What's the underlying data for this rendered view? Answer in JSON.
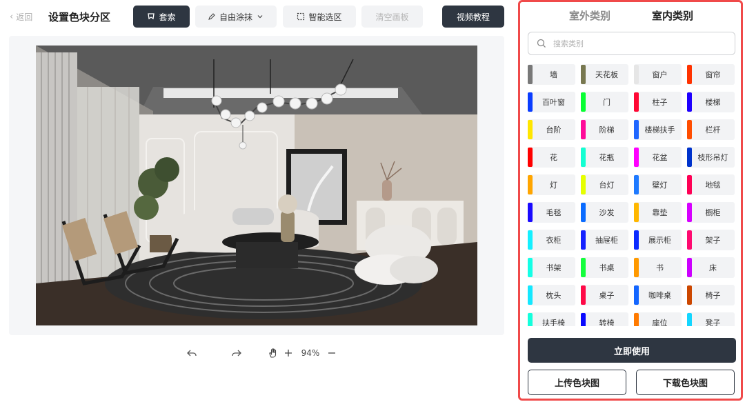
{
  "header": {
    "back_label": "返回",
    "title": "设置色块分区",
    "tools": {
      "lasso": "套索",
      "brush": "自由涂抹",
      "smart": "智能选区",
      "clear": "清空画板"
    },
    "video_tutorial": "视频教程"
  },
  "canvas": {
    "zoom": "94%"
  },
  "panel": {
    "tabs": [
      {
        "label": "室外类别",
        "active": false
      },
      {
        "label": "室内类别",
        "active": true
      }
    ],
    "search_placeholder": "搜索类别",
    "categories": [
      {
        "label": "墙",
        "color": "#787878"
      },
      {
        "label": "天花板",
        "color": "#787850"
      },
      {
        "label": "窗户",
        "color": "#e6e6e6"
      },
      {
        "label": "窗帘",
        "color": "#ff3300"
      },
      {
        "label": "百叶窗",
        "color": "#0a3dff"
      },
      {
        "label": "门",
        "color": "#08ff33"
      },
      {
        "label": "柱子",
        "color": "#ff0834"
      },
      {
        "label": "楼梯",
        "color": "#1f00ff"
      },
      {
        "label": "台阶",
        "color": "#ffe600"
      },
      {
        "label": "阶梯",
        "color": "#ff0a99"
      },
      {
        "label": "楼梯扶手",
        "color": "#1f66ff"
      },
      {
        "label": "栏杆",
        "color": "#ff4d00"
      },
      {
        "label": "花",
        "color": "#ff0000"
      },
      {
        "label": "花瓶",
        "color": "#14ffd2"
      },
      {
        "label": "花盆",
        "color": "#ff00ff"
      },
      {
        "label": "枝形吊灯",
        "color": "#0033cc"
      },
      {
        "label": "灯",
        "color": "#ffa500"
      },
      {
        "label": "台灯",
        "color": "#e6ff00"
      },
      {
        "label": "壁灯",
        "color": "#1f7aff"
      },
      {
        "label": "地毯",
        "color": "#ff0055"
      },
      {
        "label": "毛毯",
        "color": "#1a0aff"
      },
      {
        "label": "沙发",
        "color": "#0a6bff"
      },
      {
        "label": "靠垫",
        "color": "#ffb700"
      },
      {
        "label": "橱柜",
        "color": "#d600ff"
      },
      {
        "label": "衣柜",
        "color": "#14f0ff"
      },
      {
        "label": "抽屉柜",
        "color": "#1422ff"
      },
      {
        "label": "展示柜",
        "color": "#0a2aff"
      },
      {
        "label": "架子",
        "color": "#ff0a70"
      },
      {
        "label": "书架",
        "color": "#14ffe6"
      },
      {
        "label": "书桌",
        "color": "#14ff3d"
      },
      {
        "label": "书",
        "color": "#ff9900"
      },
      {
        "label": "床",
        "color": "#cc00ff"
      },
      {
        "label": "枕头",
        "color": "#14e8ff"
      },
      {
        "label": "桌子",
        "color": "#ff0a47"
      },
      {
        "label": "咖啡桌",
        "color": "#1466ff"
      },
      {
        "label": "椅子",
        "color": "#cc4700"
      },
      {
        "label": "扶手椅",
        "color": "#14ffdc"
      },
      {
        "label": "转椅",
        "color": "#0a0aff"
      },
      {
        "label": "座位",
        "color": "#ff7a00"
      },
      {
        "label": "凳子",
        "color": "#14d6ff"
      }
    ],
    "use_now": "立即使用",
    "upload": "上传色块图",
    "download": "下载色块图"
  }
}
